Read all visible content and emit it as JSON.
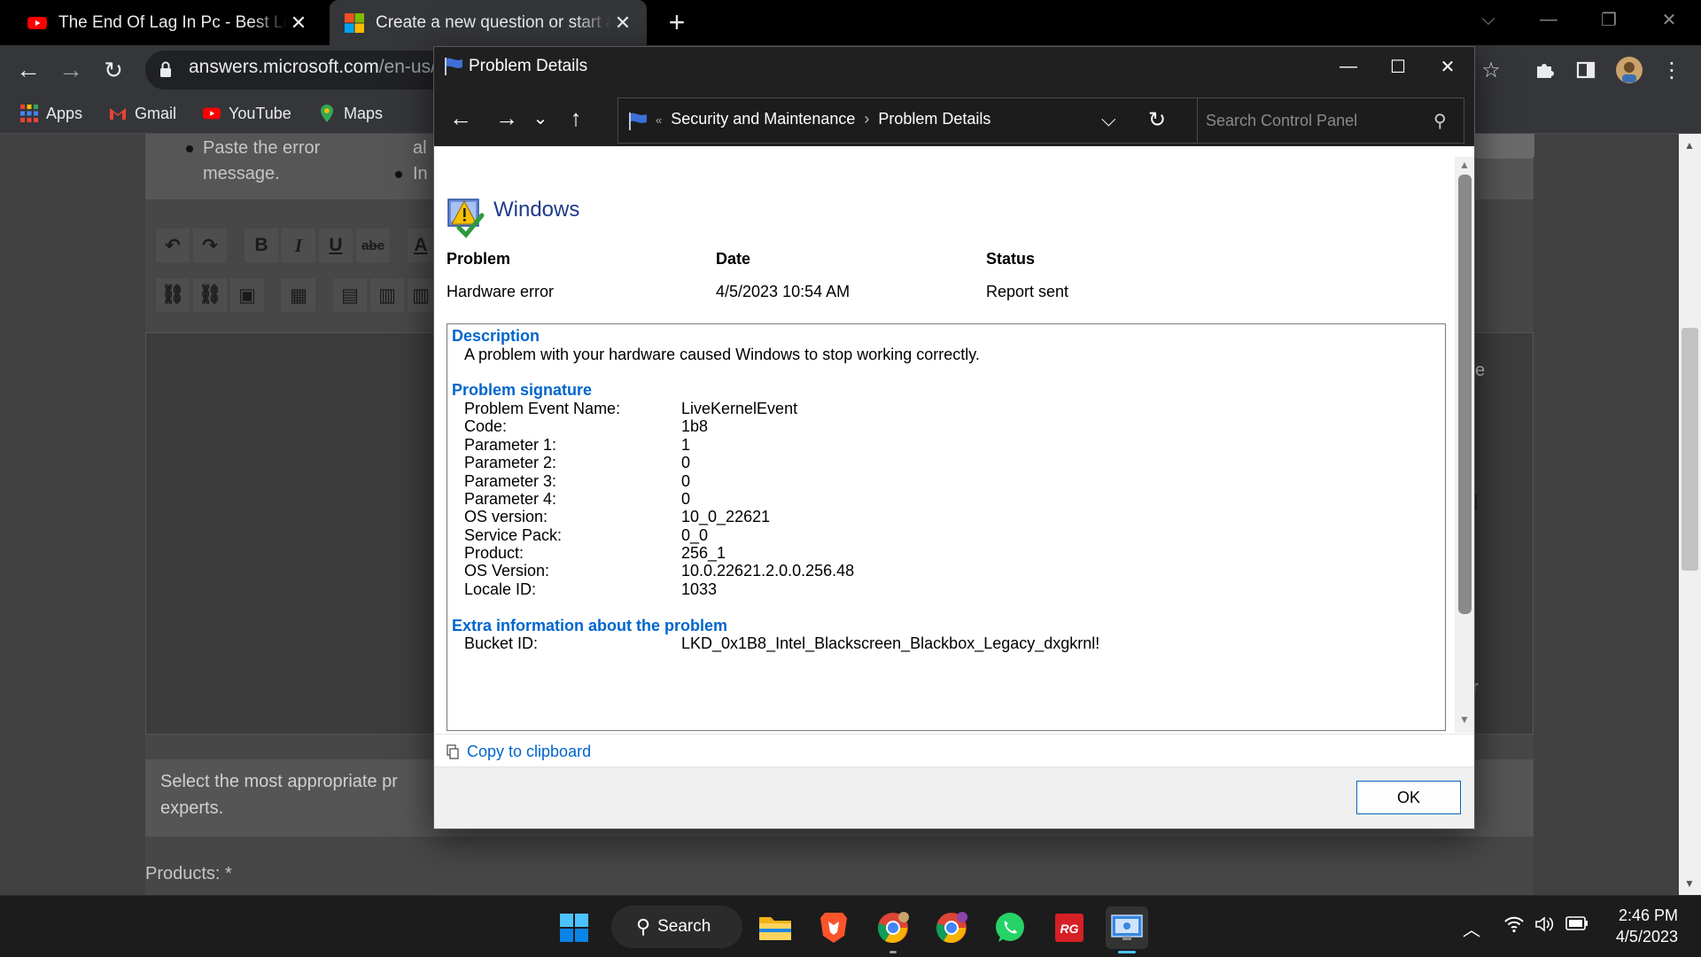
{
  "browser": {
    "tabs": [
      {
        "title": "The End Of Lag In Pc - Best Lag F",
        "icon": "youtube-icon",
        "active": false
      },
      {
        "title": "Create a new question or start a d",
        "icon": "microsoft-icon",
        "active": true
      }
    ],
    "new_tab": "+",
    "url": {
      "host": "answers.microsoft.com",
      "path": "/en-us/"
    },
    "bookmarks": [
      {
        "label": "Apps",
        "icon": "apps-grid-icon"
      },
      {
        "label": "Gmail",
        "icon": "gmail-icon"
      },
      {
        "label": "YouTube",
        "icon": "youtube-icon"
      },
      {
        "label": "Maps",
        "icon": "maps-pin-icon"
      }
    ]
  },
  "page": {
    "bullet_text_1": "Paste the error",
    "bullet_text_2": "message.",
    "partial_1": "al",
    "partial_2": "In",
    "select_text_1": "Select the most appropriate pr",
    "select_text_2": "experts.",
    "products_label": "Products: *",
    "right_partial_1": "e",
    "right_partial_2": "r"
  },
  "dialog": {
    "title": "Problem Details",
    "breadcrumb": [
      "Security and Maintenance",
      "Problem Details"
    ],
    "search_placeholder": "Search Control Panel",
    "app_name": "Windows",
    "headers": {
      "problem": "Problem",
      "date": "Date",
      "status": "Status"
    },
    "values": {
      "problem": "Hardware error",
      "date": "4/5/2023 10:54 AM",
      "status": "Report sent"
    },
    "description_title": "Description",
    "description_text": "A problem with your hardware caused Windows to stop working correctly.",
    "signature_title": "Problem signature",
    "signature": [
      {
        "k": "Problem Event Name:",
        "v": "LiveKernelEvent"
      },
      {
        "k": "Code:",
        "v": "1b8"
      },
      {
        "k": "Parameter 1:",
        "v": "1"
      },
      {
        "k": "Parameter 2:",
        "v": "0"
      },
      {
        "k": "Parameter 3:",
        "v": "0"
      },
      {
        "k": "Parameter 4:",
        "v": "0"
      },
      {
        "k": "OS version:",
        "v": "10_0_22621"
      },
      {
        "k": "Service Pack:",
        "v": "0_0"
      },
      {
        "k": "Product:",
        "v": "256_1"
      },
      {
        "k": "OS Version:",
        "v": "10.0.22621.2.0.0.256.48"
      },
      {
        "k": "Locale ID:",
        "v": "1033"
      }
    ],
    "extra_title": "Extra information about the problem",
    "extra": [
      {
        "k": "Bucket ID:",
        "v": "LKD_0x1B8_Intel_Blackscreen_Blackbox_Legacy_dxgkrnl!"
      }
    ],
    "copy_label": "Copy to clipboard",
    "ok_label": "OK"
  },
  "taskbar": {
    "search_label": "Search",
    "time": "2:46 PM",
    "date": "4/5/2023"
  },
  "colors": {
    "link": "#0066cc",
    "accent": "#0067c0",
    "title_bar": "#202020",
    "taskbar": "#1c1c1c"
  }
}
